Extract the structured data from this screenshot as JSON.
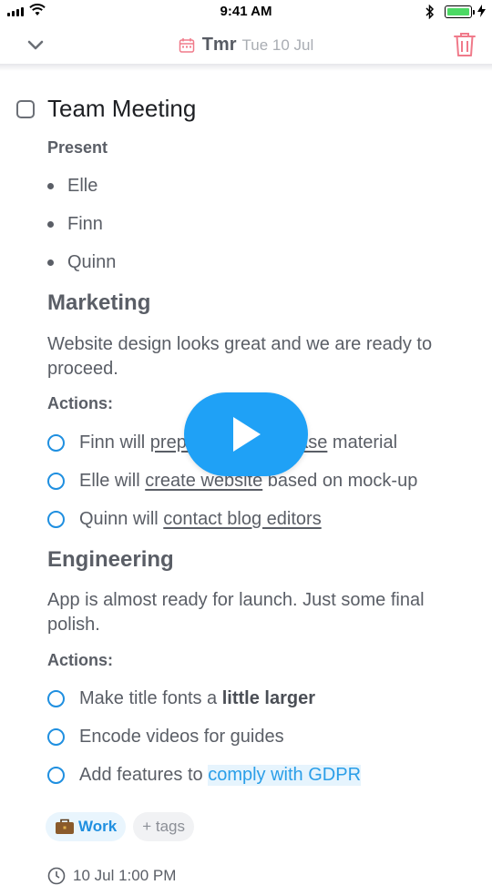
{
  "status_bar": {
    "time": "9:41 AM"
  },
  "nav": {
    "title": "Tmr",
    "date": "Tue 10 Jul"
  },
  "note": {
    "title": "Team Meeting",
    "present_heading": "Present",
    "present": [
      "Elle",
      "Finn",
      "Quinn"
    ],
    "marketing": {
      "heading": "Marketing",
      "text": "Website design looks great and we are ready to proceed.",
      "actions_heading": "Actions:",
      "todos": [
        {
          "prefix": "Finn will ",
          "link": "prepare press release",
          "suffix": " material"
        },
        {
          "prefix": "Elle will ",
          "link": "create website",
          "suffix": " based on mock-up"
        },
        {
          "prefix": "Quinn will ",
          "link": "contact blog editors",
          "suffix": ""
        }
      ]
    },
    "engineering": {
      "heading": "Engineering",
      "text": "App is almost ready for launch. Just some final polish.",
      "actions_heading": "Actions:",
      "todos": [
        {
          "prefix": "Make title fonts a ",
          "bold": "little larger"
        },
        {
          "text": "Encode videos for guides"
        },
        {
          "prefix": "Add features to ",
          "highlight": "comply with GDPR"
        }
      ]
    },
    "tags": {
      "work": "Work",
      "add": "+ tags"
    },
    "reminder": "10 Jul 1:00 PM"
  },
  "colors": {
    "accent": "#1f8fe0",
    "play": "#1fa1f6",
    "trash": "#f07a8a"
  }
}
